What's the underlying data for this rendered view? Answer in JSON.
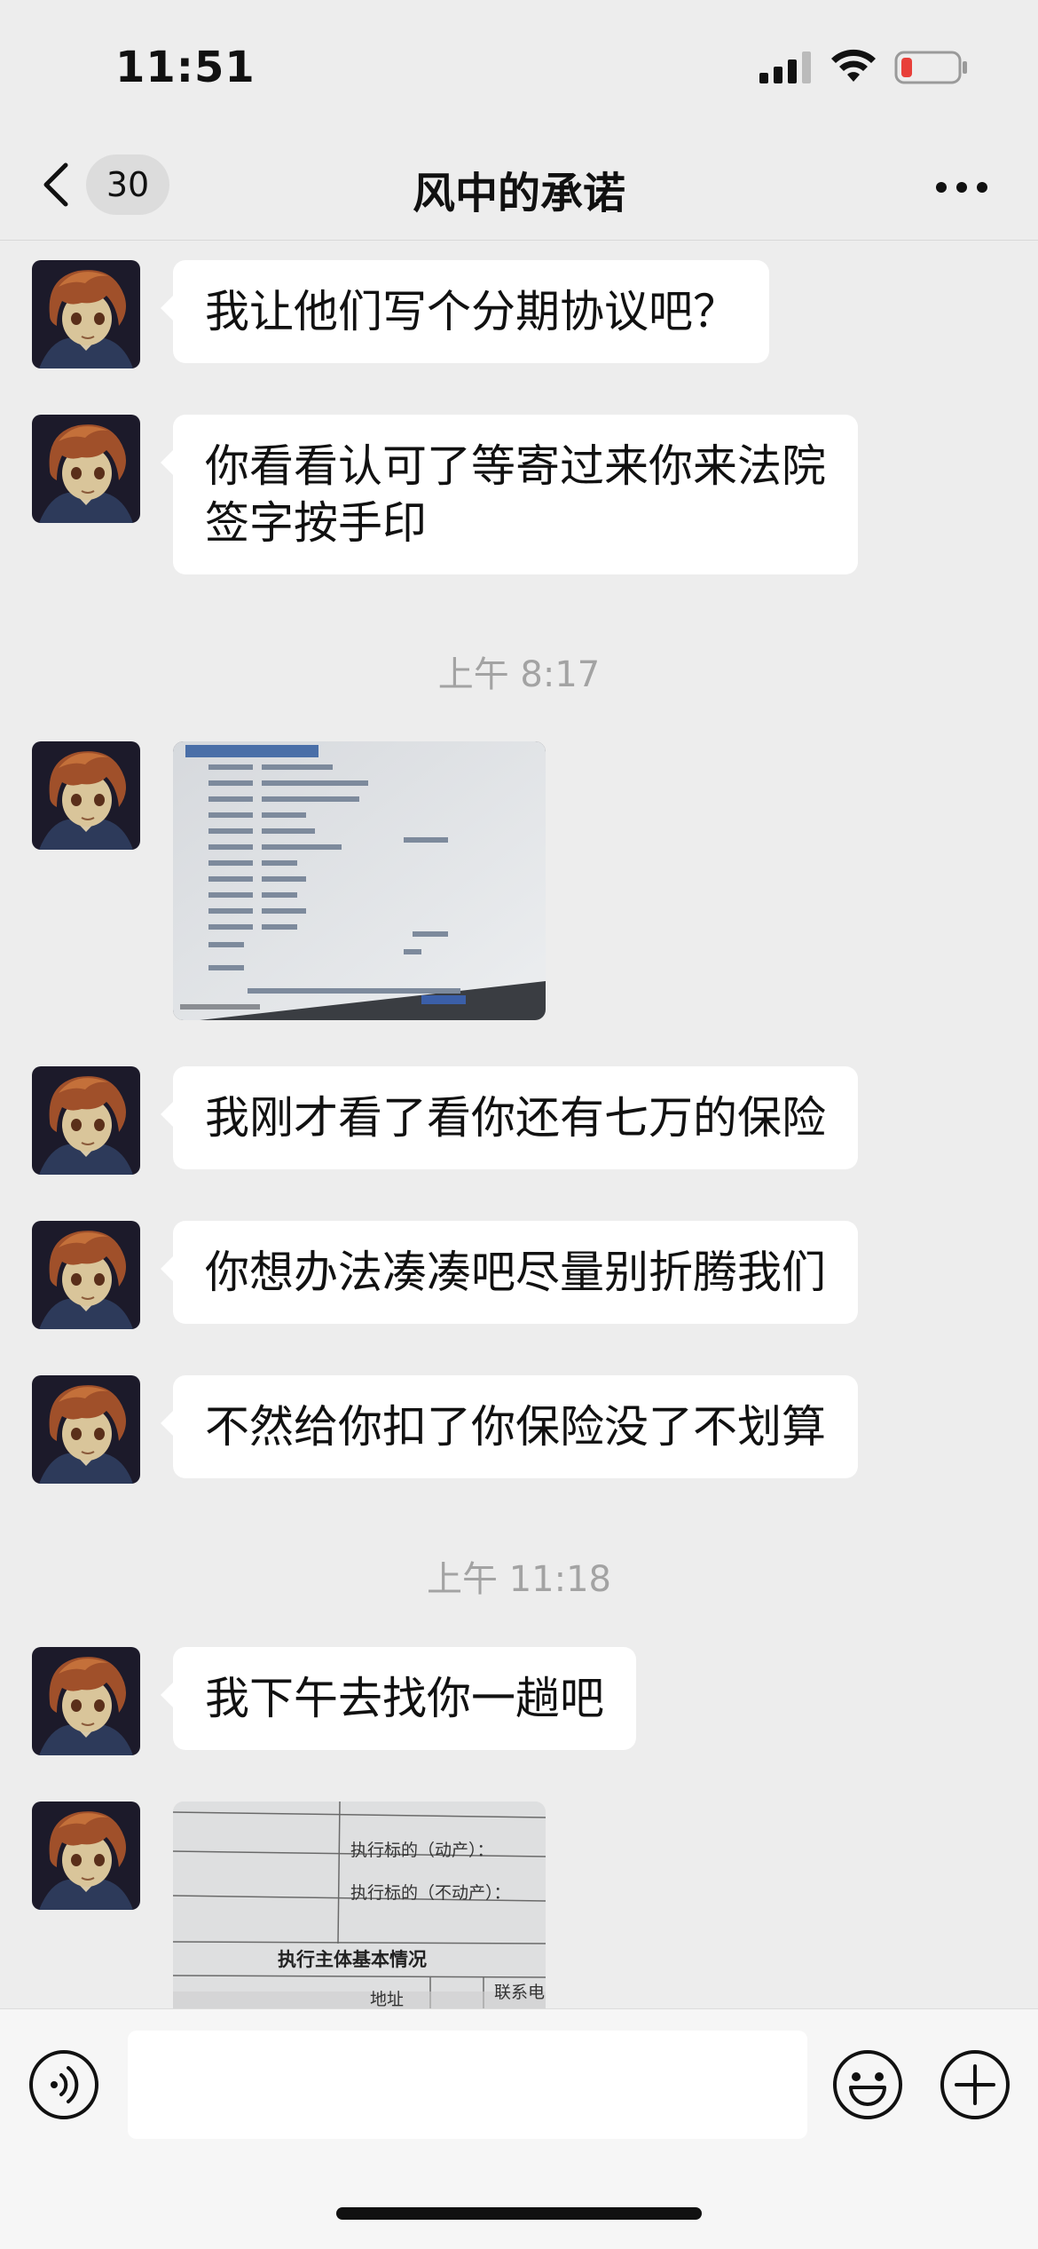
{
  "status_bar": {
    "time": "11:51"
  },
  "nav": {
    "unread_count": "30",
    "title": "风中的承诺"
  },
  "messages": [
    {
      "type": "text",
      "text": "我让他们写个分期协议吧？"
    },
    {
      "type": "text",
      "text": "你看看认可了等寄过来你来法院\n签字按手印"
    },
    {
      "type": "timestamp",
      "text": "上午 8:17"
    },
    {
      "type": "image",
      "description": "photo-of-insurance-policy-screen"
    },
    {
      "type": "text",
      "text": "我刚才看了看你还有七万的保险"
    },
    {
      "type": "text",
      "text": "你想办法凑凑吧尽量别折腾我们"
    },
    {
      "type": "text",
      "text": "不然给你扣了你保险没了不划算"
    },
    {
      "type": "timestamp",
      "text": "上午 11:18"
    },
    {
      "type": "text",
      "text": "我下午去找你一趟吧"
    },
    {
      "type": "image",
      "description": "photo-of-court-document"
    }
  ],
  "photo2_text": {
    "line1": "执行标的（动产）：",
    "line2": "执行标的（不动产）：",
    "heading": "执行主体基本情况",
    "col_address": "地址",
    "col_contact": "联系电"
  },
  "colors": {
    "background": "#ededed",
    "bubble": "#ffffff",
    "timestamp": "#a3a3a3",
    "battery_low": "#e8403a"
  }
}
